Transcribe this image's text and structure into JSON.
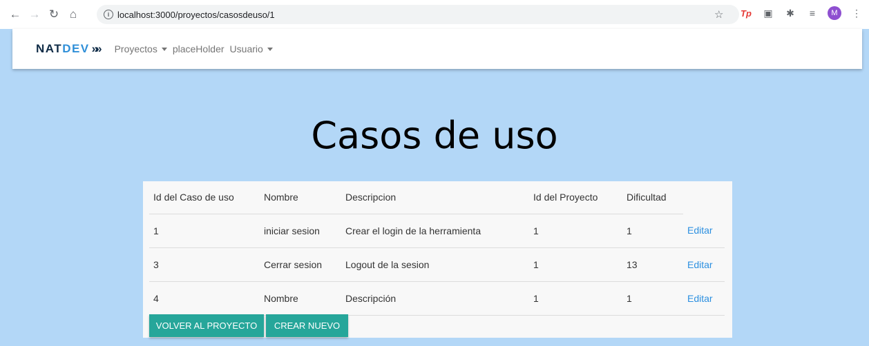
{
  "browser": {
    "url": "localhost:3000/proyectos/casosdeuso/1",
    "avatar_letter": "M",
    "tp_label": "Tp"
  },
  "navbar": {
    "brand_nat": "NAT",
    "brand_dev": "DEV",
    "links": [
      "Proyectos",
      "placeHolder",
      "Usuario"
    ]
  },
  "page": {
    "title": "Casos de uso"
  },
  "table": {
    "headers": [
      "Id del Caso de uso",
      "Nombre",
      "Descripcion",
      "Id del Proyecto",
      "Dificultad"
    ],
    "edit_label": "Editar",
    "rows": [
      [
        "1",
        "iniciar sesion",
        "Crear el login de la herramienta",
        "1",
        "1"
      ],
      [
        "3",
        "Cerrar sesion",
        "Logout de la sesion",
        "1",
        "13"
      ],
      [
        "4",
        "Nombre",
        "Descripción",
        "1",
        "1"
      ]
    ]
  },
  "actions": {
    "back_label": "VOLVER AL PROYECTO",
    "new_label": "CREAR NUEVO"
  },
  "colors": {
    "background": "#b3d7f7",
    "button": "#26a69a",
    "link": "#2b8fe0"
  }
}
